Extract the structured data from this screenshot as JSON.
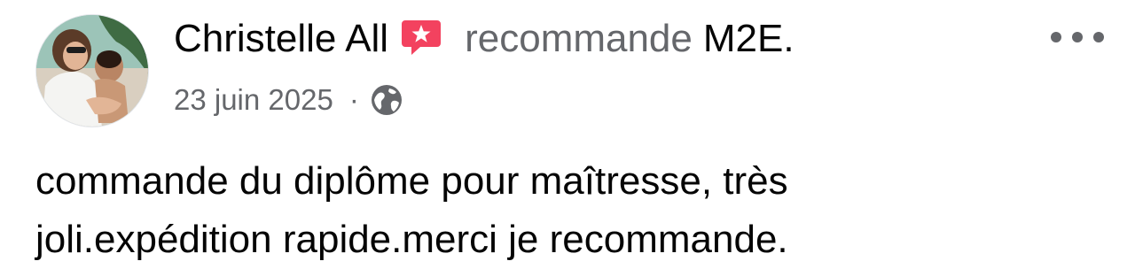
{
  "post": {
    "author_name": "Christelle All",
    "verb": "recommande",
    "page_name": "M2E.",
    "date": "23 juin 2025",
    "separator": "·",
    "privacy_icon": "globe-icon",
    "recommend_icon": "recommend-badge-icon",
    "more_icon": "more-options-icon",
    "body_text": "commande du diplôme pour maîtresse, très\njoli.expédition rapide.merci je recommande."
  },
  "colors": {
    "primary_text": "#050505",
    "secondary_text": "#65676b",
    "recommend_badge": "#f3425f",
    "background": "#ffffff"
  }
}
